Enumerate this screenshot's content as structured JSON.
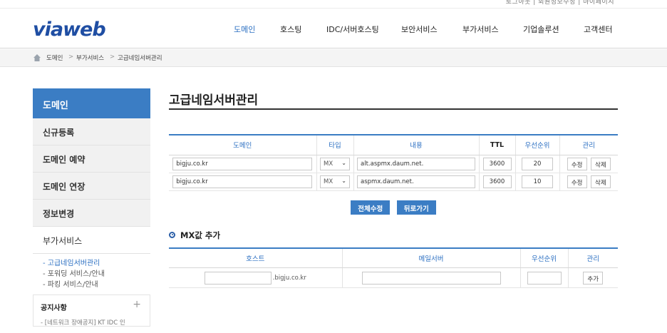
{
  "topbar": {
    "util": "로그아웃 | 회원정보수정 | 마이페이지"
  },
  "logo": "viaweb",
  "nav": [
    {
      "label": "도메인",
      "active": true
    },
    {
      "label": "호스팅"
    },
    {
      "label": "IDC/서버호스팅"
    },
    {
      "label": "보안서비스"
    },
    {
      "label": "부가서비스"
    },
    {
      "label": "기업솔루션"
    },
    {
      "label": "고객센터"
    }
  ],
  "breadcrumb": [
    "도메인",
    "부가서비스",
    "고급네임서버관리"
  ],
  "sidebar": {
    "title": "도메인",
    "items": [
      "신규등록",
      "도메인 예약",
      "도메인 연장",
      "정보변경",
      "부가서비스"
    ],
    "sub": [
      "- 고급네임서버관리",
      "- 포워딩 서비스/안내",
      "- 파킹 서비스/안내"
    ],
    "notice": {
      "title": "공지사항",
      "plus": "+",
      "item": "- [네트워크 장애공지] KT IDC 인"
    }
  },
  "main": {
    "title": "고급네임서버관리",
    "records_table": {
      "headers": [
        "도메인",
        "타입",
        "내용",
        "TTL",
        "우선순위",
        "관리"
      ],
      "rows": [
        {
          "domain": "bigju.co.kr",
          "type": "MX",
          "content": "alt.aspmx.daum.net.",
          "ttl": "3600",
          "priority": "20"
        },
        {
          "domain": "bigju.co.kr",
          "type": "MX",
          "content": "aspmx.daum.net.",
          "ttl": "3600",
          "priority": "10"
        }
      ],
      "edit_label": "수정",
      "delete_label": "삭제"
    },
    "buttons": {
      "edit_all": "전체수정",
      "back": "뒤로가기"
    },
    "add_section": {
      "title": "MX값 추가",
      "headers": [
        "호스트",
        "메일서버",
        "우선순위",
        "관리"
      ],
      "domain_suffix": ".bigju.co.kr",
      "add_label": "추가"
    }
  },
  "colors": {
    "accent": "#3b7dc4",
    "link": "#2b6fc2"
  }
}
